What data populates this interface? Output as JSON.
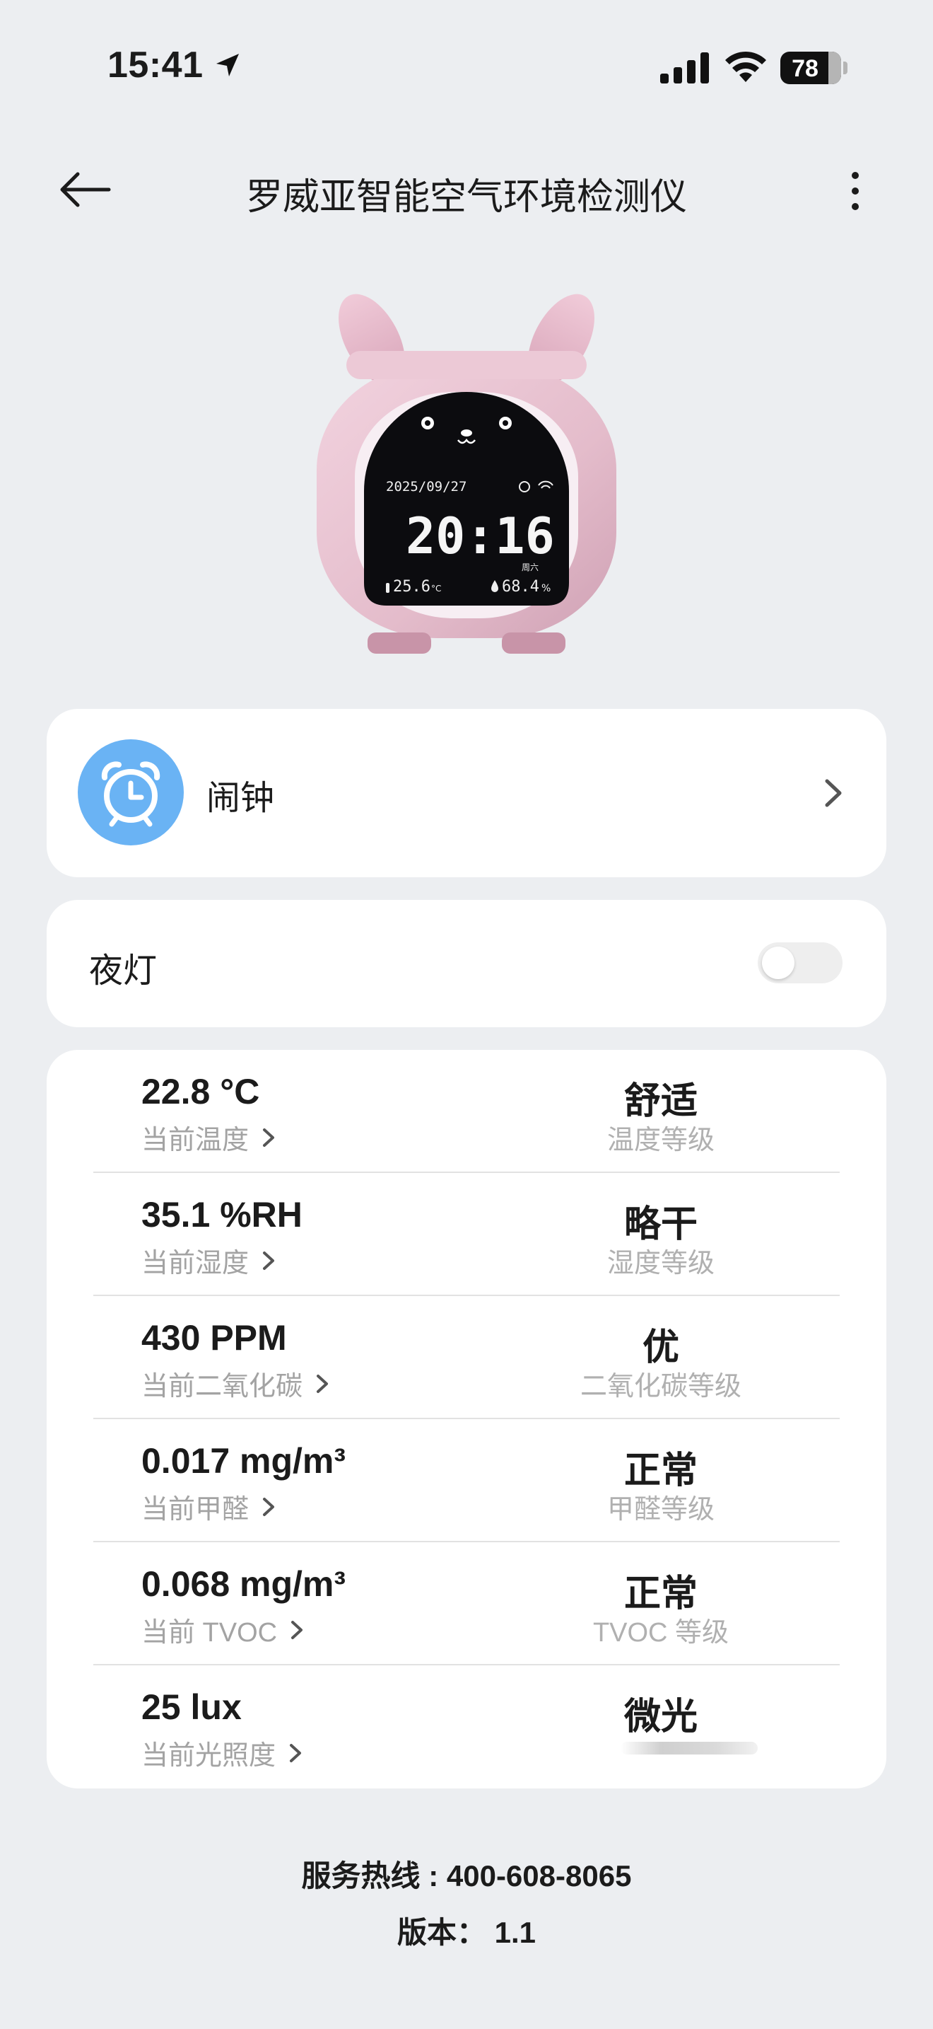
{
  "status_bar": {
    "time": "15:41",
    "battery": "78"
  },
  "nav": {
    "title": "罗威亚智能空气环境检测仪"
  },
  "device_screen": {
    "date": "2025/09/27",
    "clock": "20:16",
    "weekday": "周六",
    "temperature": "25.6",
    "temp_unit": "°C",
    "humidity": "68.4",
    "humidity_unit": "%"
  },
  "alarm": {
    "label": "闹钟"
  },
  "night_light": {
    "label": "夜灯",
    "on": false
  },
  "metrics": [
    {
      "value": "22.8 °C",
      "label": "当前温度",
      "level": "舒适",
      "level_label": "温度等级"
    },
    {
      "value": "35.1 %RH",
      "label": "当前湿度",
      "level": "略干",
      "level_label": "湿度等级"
    },
    {
      "value": "430 PPM",
      "label": "当前二氧化碳",
      "level": "优",
      "level_label": "二氧化碳等级"
    },
    {
      "value": "0.017 mg/m³",
      "label": "当前甲醛",
      "level": "正常",
      "level_label": "甲醛等级"
    },
    {
      "value": "0.068 mg/m³",
      "label": "当前 TVOC",
      "level": "正常",
      "level_label": "TVOC 等级"
    },
    {
      "value": "25 lux",
      "label": "当前光照度",
      "level": "微光",
      "level_label": ""
    }
  ],
  "footer": {
    "hotline": "服务热线 : 400-608-8065",
    "version": "版本： 1.1"
  },
  "colors": {
    "alarm_icon_bg": "#6ab3f4",
    "background": "#eceef1"
  }
}
